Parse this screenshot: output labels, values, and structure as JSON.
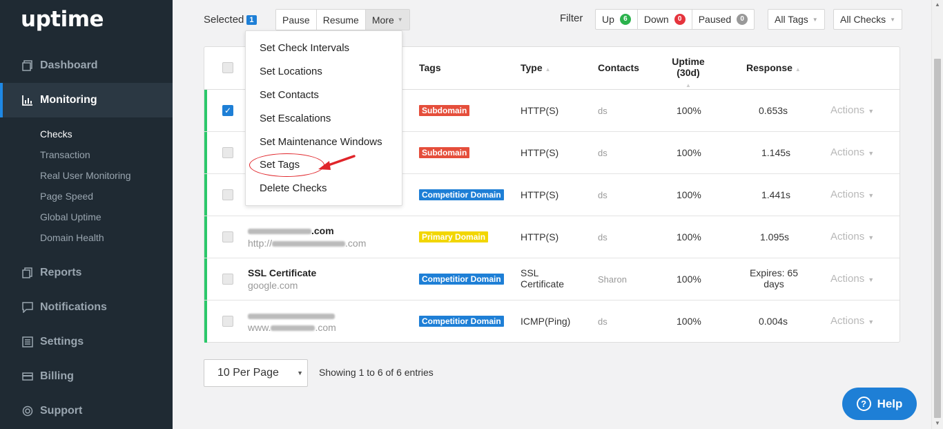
{
  "sidebar": {
    "logo": "uptime",
    "nav": [
      {
        "label": "Dashboard",
        "icon": "dashboard-icon"
      },
      {
        "label": "Monitoring",
        "icon": "chart-icon"
      },
      {
        "label": "Reports",
        "icon": "reports-icon"
      },
      {
        "label": "Notifications",
        "icon": "notifications-icon"
      },
      {
        "label": "Settings",
        "icon": "settings-icon"
      },
      {
        "label": "Billing",
        "icon": "billing-icon"
      },
      {
        "label": "Support",
        "icon": "support-icon"
      }
    ],
    "sub": [
      "Checks",
      "Transaction",
      "Real User Monitoring",
      "Page Speed",
      "Global Uptime",
      "Domain Health"
    ]
  },
  "toolbar": {
    "selected_label": "Selected",
    "selected_count": "1",
    "pause": "Pause",
    "resume": "Resume",
    "more": "More",
    "filter_label": "Filter",
    "up": "Up",
    "up_count": "6",
    "down": "Down",
    "down_count": "0",
    "paused": "Paused",
    "paused_count": "0",
    "all_tags": "All Tags",
    "all_checks": "All Checks"
  },
  "menu": [
    "Set Check Intervals",
    "Set Locations",
    "Set Contacts",
    "Set Escalations",
    "Set Maintenance Windows",
    "Set Tags",
    "Delete Checks"
  ],
  "table": {
    "headers": {
      "tags": "Tags",
      "type": "Type",
      "contacts": "Contacts",
      "uptime": "Uptime (30d)",
      "response": "Response"
    },
    "rows": [
      {
        "name": "",
        "url": "",
        "tag": "Subdomain",
        "type": "HTTP(S)",
        "contact": "ds",
        "uptime": "100%",
        "response": "0.653s",
        "checked": true
      },
      {
        "name": "",
        "url": "",
        "tag": "Subdomain",
        "type": "HTTP(S)",
        "contact": "ds",
        "uptime": "100%",
        "response": "1.145s",
        "checked": false
      },
      {
        "name": "",
        "url": "",
        "tag": "Competitior Domain",
        "type": "HTTP(S)",
        "contact": "ds",
        "uptime": "100%",
        "response": "1.441s",
        "checked": false
      },
      {
        "name": ".com",
        "url": "http://",
        "url_tail": ".com",
        "tag": "Primary Domain",
        "type": "HTTP(S)",
        "contact": "ds",
        "uptime": "100%",
        "response": "1.095s",
        "checked": false
      },
      {
        "name": "SSL Certificate",
        "url": "google.com",
        "tag": "Competitior Domain",
        "type": "SSL",
        "type2": "Certificate",
        "contact": "Sharon",
        "uptime": "100%",
        "response": "Expires: 65",
        "response2": "days",
        "checked": false
      },
      {
        "name": "",
        "url": "www.",
        "url_tail": ".com",
        "tag": "Competitior Domain",
        "type": "ICMP(Ping)",
        "contact": "ds",
        "uptime": "100%",
        "response": "0.004s",
        "checked": false
      }
    ],
    "actions_label": "Actions"
  },
  "footer": {
    "per_page": "10 Per Page",
    "showing": "Showing 1 to 6 of 6 entries",
    "help": "Help"
  },
  "colors": {
    "sidebar_bg": "#1f2a33",
    "accent": "#1e7fd6",
    "status_green": "#2bc86a",
    "tag_red": "#e54e3b",
    "tag_yellow": "#f2d602",
    "annotation_red": "#e0252a"
  }
}
